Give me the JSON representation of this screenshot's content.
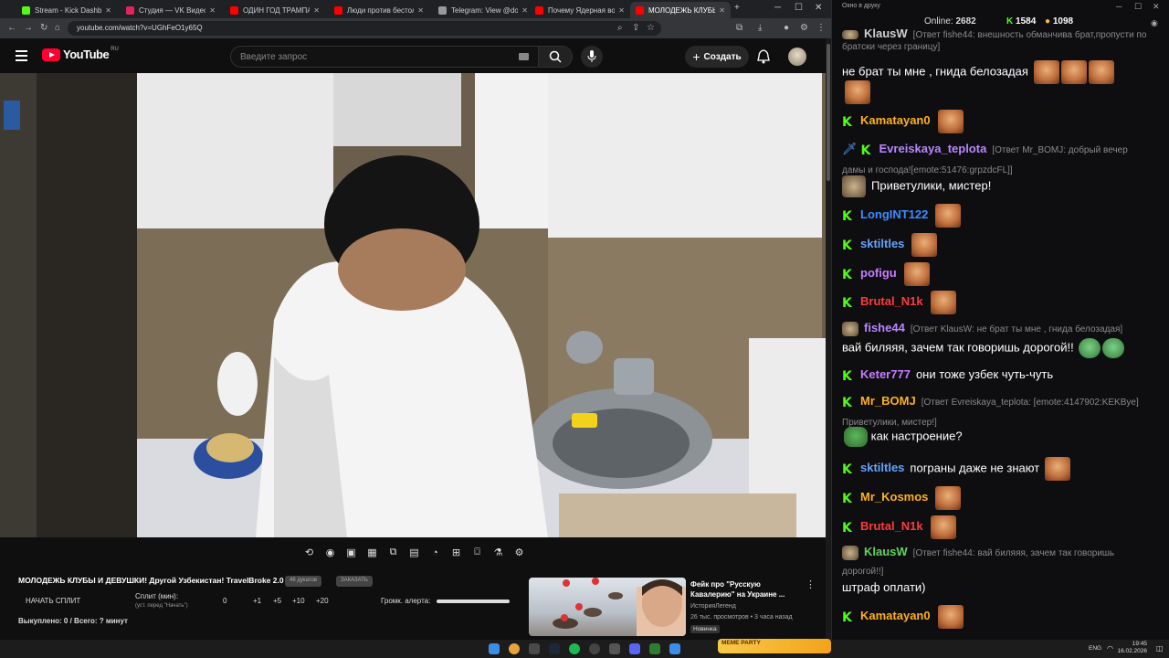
{
  "browser": {
    "tabs": [
      {
        "label": "Stream - Kick Dashboard",
        "color": "#53fc18",
        "active": false
      },
      {
        "label": "Студия — VK Видео Live",
        "color": "#e0245e",
        "active": false
      },
      {
        "label": "ОДИН ГОД ТРАМПА - YouTube",
        "color": "#ff0000",
        "active": false
      },
      {
        "label": "Люди против бестолковых",
        "color": "#ff0000",
        "active": false
      },
      {
        "label": "Telegram: View @dobro_2ch",
        "color": "#999999",
        "active": false
      },
      {
        "label": "Почему Ядерная война уже",
        "color": "#ff0000",
        "active": false
      },
      {
        "label": "МОЛОДЕЖЬ КЛУБЫ И ДЕВУШКИ",
        "color": "#ff0000",
        "active": true
      }
    ],
    "url": "youtube.com/watch?v=UGhFeO1y65Q"
  },
  "youtube": {
    "logo_text": "YouTube",
    "logo_region": "RU",
    "search_placeholder": "Введите запрос",
    "create_label": "Создать",
    "video_title": "МОЛОДЕЖЬ КЛУБЫ И ДЕВУШКИ! Другой Узбекистан! TravelBroke 2.0",
    "pill_1": "48 дукатов",
    "pill_2": "ЗАКАЗАТЬ",
    "split_button": "НАЧАТЬ СПЛИТ",
    "split_label": "Сплит (мин):",
    "split_sub": "(уст. перед \"Начать\")",
    "split_values": [
      "0",
      "+1",
      "+5",
      "+10",
      "+20"
    ],
    "alert_volume_label": "Громк. алерта:",
    "bought_label": "Выкуплено: 0 / Всего: ? минут",
    "recommendation": {
      "title": "Фейк про \"Русскую Кавалерию\" на Украине ...",
      "channel": "ИсторияЛегенд",
      "meta": "26 тыс. просмотров • 3 часа назад",
      "badge": "Новинка"
    }
  },
  "chat": {
    "window_title": "Окно в друку",
    "online_label": "Online:",
    "online_value": "2682",
    "kick_count": "1584",
    "coin_count": "1098",
    "messages": [
      {
        "user": "KlausW",
        "color": "#cfcfcf",
        "reply": "[Ответ fishe44: внешность обманчива брат,пропусти по братски через границу]",
        "text": "не брат ты мне , гнида белозадая"
      },
      {
        "user": "Kamatayan0",
        "color": "#ffb020",
        "reply": "",
        "text": ""
      },
      {
        "user": "Evreiskaya_teplota",
        "color": "#b986ff",
        "reply": "[Ответ Mr_BOMJ: добрый вечер дамы и господа![emote:51476:grpzdcFL]]",
        "text": "Приветулики, мистер!"
      },
      {
        "user": "LongINT122",
        "color": "#3d8bff",
        "reply": "",
        "text": ""
      },
      {
        "user": "sktiltles",
        "color": "#66a3ff",
        "reply": "",
        "text": ""
      },
      {
        "user": "pofigu",
        "color": "#c77dff",
        "reply": "",
        "text": ""
      },
      {
        "user": "Brutal_N1k",
        "color": "#ff3b3b",
        "reply": "",
        "text": ""
      },
      {
        "user": "fishe44",
        "color": "#b986ff",
        "reply": "[Ответ KlausW: не брат ты мне , гнида белозадая]",
        "text": "вай биляяя, зачем так говоришь дорогой!!"
      },
      {
        "user": "Keter777",
        "color": "#c77dff",
        "reply": "",
        "text": "они тоже узбек чуть-чуть"
      },
      {
        "user": "Mr_BOMJ",
        "color": "#ffb020",
        "reply": "[Ответ Evreiskaya_teplota: [emote:4147902:KEKBye] Приветулики, мистер!]",
        "text": "как настроение?"
      },
      {
        "user": "sktiltles",
        "color": "#66a3ff",
        "reply": "",
        "text": "пограны даже не знают"
      },
      {
        "user": "Mr_Kosmos",
        "color": "#ffb020",
        "reply": "",
        "text": ""
      },
      {
        "user": "Brutal_N1k",
        "color": "#ff3b3b",
        "reply": "",
        "text": ""
      },
      {
        "user": "KlausW",
        "color": "#5fd35f",
        "reply": "[Ответ fishe44: вай биляяя, зачем так говоришь дорогой!!]",
        "text": "штраф оплати)"
      },
      {
        "user": "Kamatayan0",
        "color": "#ffb020",
        "reply": "",
        "text": ""
      }
    ]
  },
  "taskbar": {
    "lang": "ENG",
    "time": "19:45",
    "date": "16.02.2026",
    "widget": "MEME PARTY"
  }
}
